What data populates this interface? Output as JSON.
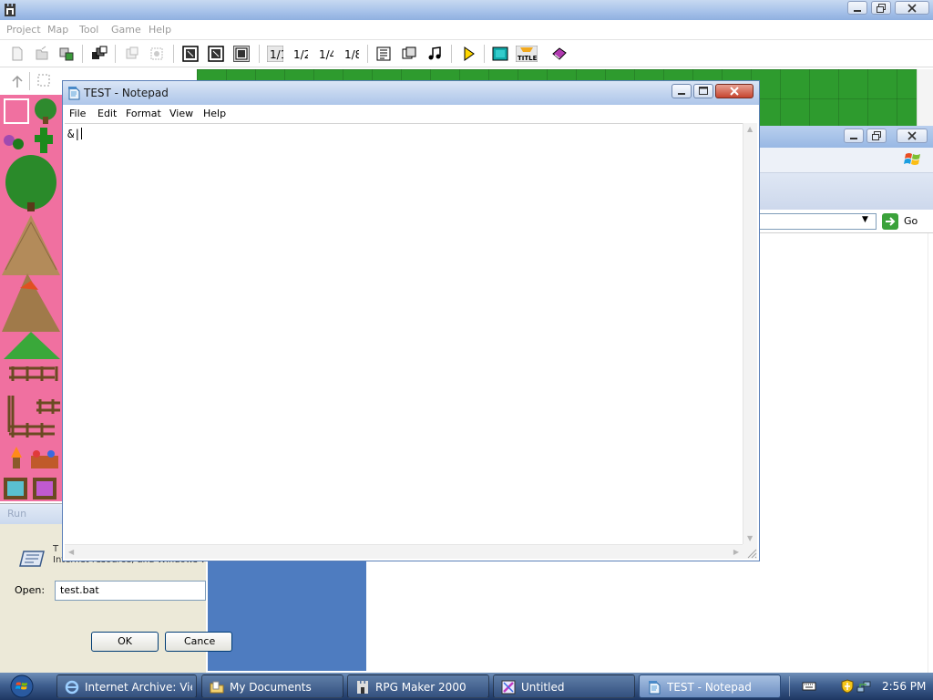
{
  "rpgmaker": {
    "menu": [
      "Project",
      "Map",
      "Tool",
      "Game",
      "Help"
    ],
    "toolbar_icons": [
      "new-project-icon",
      "open-project-icon",
      "close-project-icon",
      "cascade-icon",
      "chipset-icon",
      "layer-icon",
      "map-zoom-icon",
      "event-layer-icon",
      "draw-layer-icon",
      "zoom-1-1-icon",
      "zoom-1-2-icon",
      "zoom-1-4-icon",
      "zoom-1-8-icon",
      "database-icon",
      "material-icon",
      "music-icon",
      "playtest-icon",
      "fullscreen-icon",
      "title-icon",
      "help-book-icon"
    ],
    "zoom_labels": [
      "1/1",
      "1/2",
      "1/4",
      "1/8"
    ],
    "title_badge": "TITLE",
    "tileset_selected_color": "#f070a0",
    "map_grass_color": "#2e9b2e"
  },
  "notepad": {
    "title": "TEST - Notepad",
    "menu": [
      "File",
      "Edit",
      "Format",
      "View",
      "Help"
    ],
    "content": "&|"
  },
  "ie": {
    "go_label": "Go"
  },
  "run_dialog": {
    "title": "Run",
    "description_line1": "T",
    "description_line2": "Internet resource, and Windows w",
    "open_label": "Open:",
    "open_value": "test.bat",
    "ok_label": "OK",
    "cancel_label": "Cance"
  },
  "taskbar": {
    "items": [
      {
        "label": "Internet Archive: Vie...",
        "icon": "internet-explorer-icon",
        "active": false
      },
      {
        "label": "My Documents",
        "icon": "folder-icon",
        "active": false
      },
      {
        "label": "RPG Maker 2000",
        "icon": "rpg-maker-icon",
        "active": false
      },
      {
        "label": "Untitled",
        "icon": "paint-icon",
        "active": false
      },
      {
        "label": "TEST - Notepad",
        "icon": "notepad-icon",
        "active": true
      }
    ],
    "clock": "2:56 PM"
  }
}
